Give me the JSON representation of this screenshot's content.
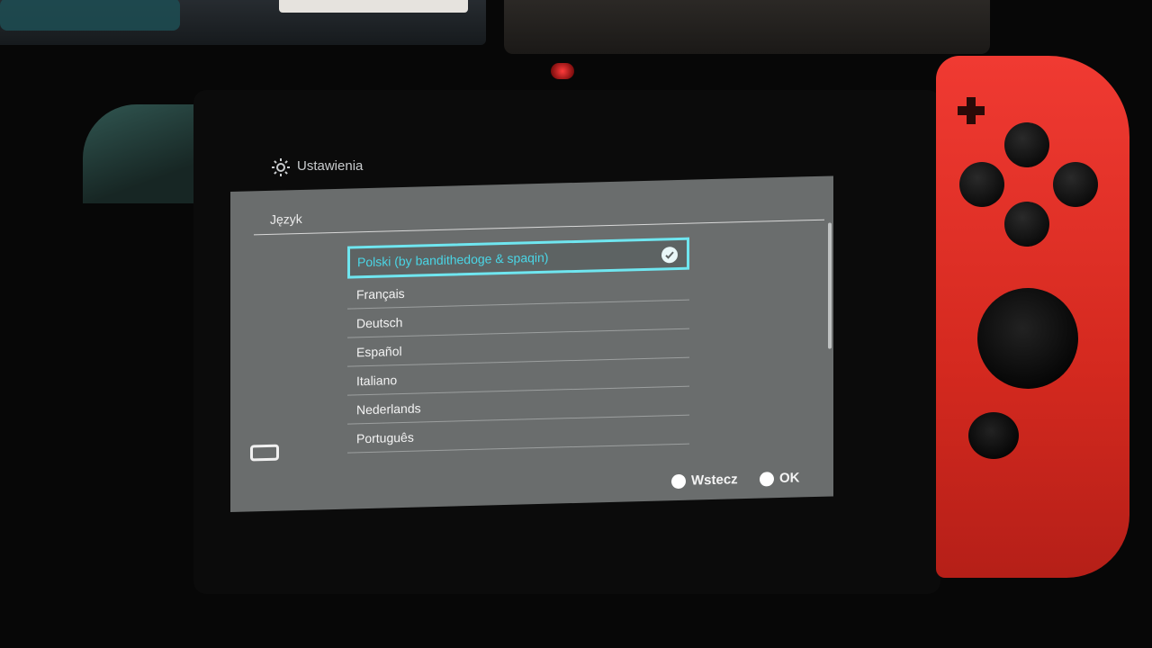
{
  "header": {
    "title": "Ustawienia",
    "icon": "gear-icon"
  },
  "panel": {
    "heading": "Język"
  },
  "languages": [
    {
      "label": "Polski (by bandithedoge & spaqin)",
      "selected": true
    },
    {
      "label": "Français",
      "selected": false
    },
    {
      "label": "Deutsch",
      "selected": false
    },
    {
      "label": "Español",
      "selected": false
    },
    {
      "label": "Italiano",
      "selected": false
    },
    {
      "label": "Nederlands",
      "selected": false
    },
    {
      "label": "Português",
      "selected": false
    }
  ],
  "footer": {
    "back_label": "Wstecz",
    "ok_label": "OK"
  },
  "colors": {
    "accent": "#6fe6f0",
    "screen_bg": "#6a6d6d",
    "joycon_red": "#e5332a"
  }
}
